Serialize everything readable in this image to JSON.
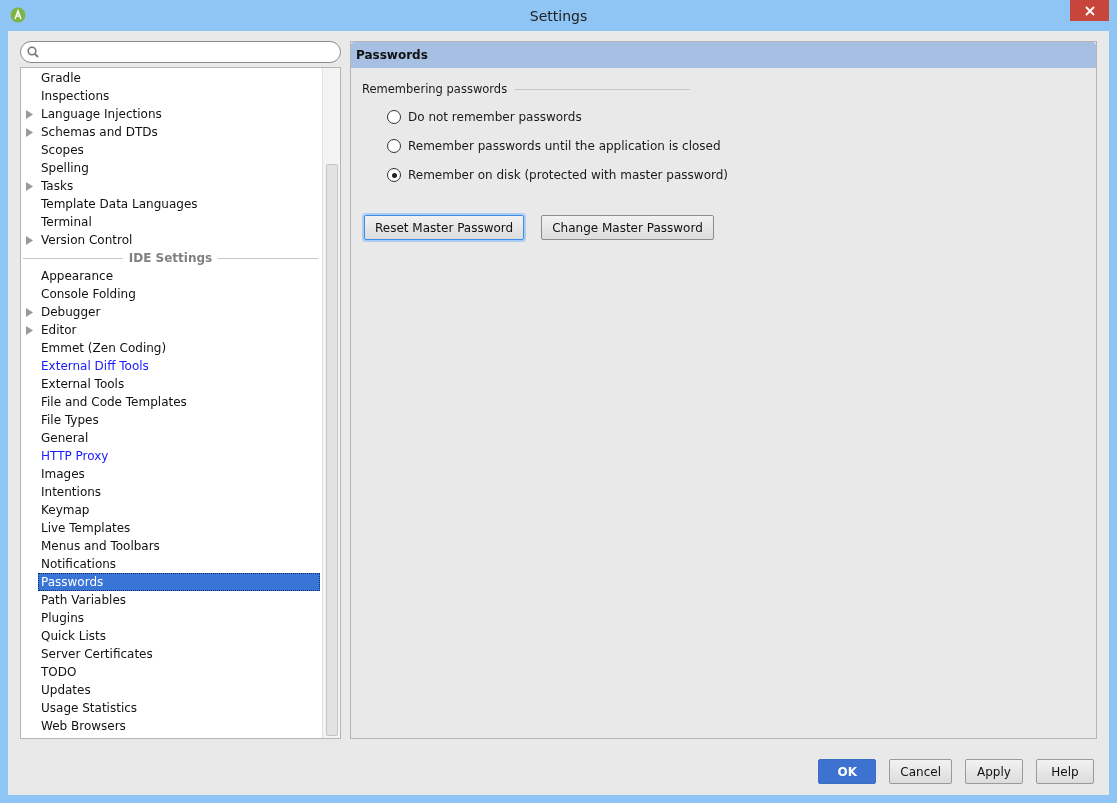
{
  "window": {
    "title": "Settings"
  },
  "tree": [
    {
      "kind": "item",
      "label": "Gradle",
      "expandable": false,
      "highlighted": false,
      "selected": false
    },
    {
      "kind": "item",
      "label": "Inspections",
      "expandable": false,
      "highlighted": false,
      "selected": false
    },
    {
      "kind": "item",
      "label": "Language Injections",
      "expandable": true,
      "highlighted": false,
      "selected": false
    },
    {
      "kind": "item",
      "label": "Schemas and DTDs",
      "expandable": true,
      "highlighted": false,
      "selected": false
    },
    {
      "kind": "item",
      "label": "Scopes",
      "expandable": false,
      "highlighted": false,
      "selected": false
    },
    {
      "kind": "item",
      "label": "Spelling",
      "expandable": false,
      "highlighted": false,
      "selected": false
    },
    {
      "kind": "item",
      "label": "Tasks",
      "expandable": true,
      "highlighted": false,
      "selected": false
    },
    {
      "kind": "item",
      "label": "Template Data Languages",
      "expandable": false,
      "highlighted": false,
      "selected": false
    },
    {
      "kind": "item",
      "label": "Terminal",
      "expandable": false,
      "highlighted": false,
      "selected": false
    },
    {
      "kind": "item",
      "label": "Version Control",
      "expandable": true,
      "highlighted": false,
      "selected": false
    },
    {
      "kind": "separator",
      "label": "IDE Settings"
    },
    {
      "kind": "item",
      "label": "Appearance",
      "expandable": false,
      "highlighted": false,
      "selected": false
    },
    {
      "kind": "item",
      "label": "Console Folding",
      "expandable": false,
      "highlighted": false,
      "selected": false
    },
    {
      "kind": "item",
      "label": "Debugger",
      "expandable": true,
      "highlighted": false,
      "selected": false
    },
    {
      "kind": "item",
      "label": "Editor",
      "expandable": true,
      "highlighted": false,
      "selected": false
    },
    {
      "kind": "item",
      "label": "Emmet (Zen Coding)",
      "expandable": false,
      "highlighted": false,
      "selected": false
    },
    {
      "kind": "item",
      "label": "External Diff Tools",
      "expandable": false,
      "highlighted": true,
      "selected": false
    },
    {
      "kind": "item",
      "label": "External Tools",
      "expandable": false,
      "highlighted": false,
      "selected": false
    },
    {
      "kind": "item",
      "label": "File and Code Templates",
      "expandable": false,
      "highlighted": false,
      "selected": false
    },
    {
      "kind": "item",
      "label": "File Types",
      "expandable": false,
      "highlighted": false,
      "selected": false
    },
    {
      "kind": "item",
      "label": "General",
      "expandable": false,
      "highlighted": false,
      "selected": false
    },
    {
      "kind": "item",
      "label": "HTTP Proxy",
      "expandable": false,
      "highlighted": true,
      "selected": false
    },
    {
      "kind": "item",
      "label": "Images",
      "expandable": false,
      "highlighted": false,
      "selected": false
    },
    {
      "kind": "item",
      "label": "Intentions",
      "expandable": false,
      "highlighted": false,
      "selected": false
    },
    {
      "kind": "item",
      "label": "Keymap",
      "expandable": false,
      "highlighted": false,
      "selected": false
    },
    {
      "kind": "item",
      "label": "Live Templates",
      "expandable": false,
      "highlighted": false,
      "selected": false
    },
    {
      "kind": "item",
      "label": "Menus and Toolbars",
      "expandable": false,
      "highlighted": false,
      "selected": false
    },
    {
      "kind": "item",
      "label": "Notifications",
      "expandable": false,
      "highlighted": false,
      "selected": false
    },
    {
      "kind": "item",
      "label": "Passwords",
      "expandable": false,
      "highlighted": false,
      "selected": true
    },
    {
      "kind": "item",
      "label": "Path Variables",
      "expandable": false,
      "highlighted": false,
      "selected": false
    },
    {
      "kind": "item",
      "label": "Plugins",
      "expandable": false,
      "highlighted": false,
      "selected": false
    },
    {
      "kind": "item",
      "label": "Quick Lists",
      "expandable": false,
      "highlighted": false,
      "selected": false
    },
    {
      "kind": "item",
      "label": "Server Certificates",
      "expandable": false,
      "highlighted": false,
      "selected": false
    },
    {
      "kind": "item",
      "label": "TODO",
      "expandable": false,
      "highlighted": false,
      "selected": false
    },
    {
      "kind": "item",
      "label": "Updates",
      "expandable": false,
      "highlighted": false,
      "selected": false
    },
    {
      "kind": "item",
      "label": "Usage Statistics",
      "expandable": false,
      "highlighted": false,
      "selected": false
    },
    {
      "kind": "item",
      "label": "Web Browsers",
      "expandable": false,
      "highlighted": false,
      "selected": false
    }
  ],
  "panel": {
    "title": "Passwords",
    "group_title": "Remembering passwords",
    "options": [
      {
        "label": "Do not remember passwords",
        "selected": false
      },
      {
        "label": "Remember passwords until the application is closed",
        "selected": false
      },
      {
        "label": "Remember on disk (protected with master password)",
        "selected": true
      }
    ],
    "buttons": [
      {
        "label": "Reset Master Password",
        "focused": true
      },
      {
        "label": "Change Master Password",
        "focused": false
      }
    ]
  },
  "footer_buttons": [
    {
      "label": "OK",
      "primary": true
    },
    {
      "label": "Cancel",
      "primary": false
    },
    {
      "label": "Apply",
      "primary": false
    },
    {
      "label": "Help",
      "primary": false
    }
  ]
}
